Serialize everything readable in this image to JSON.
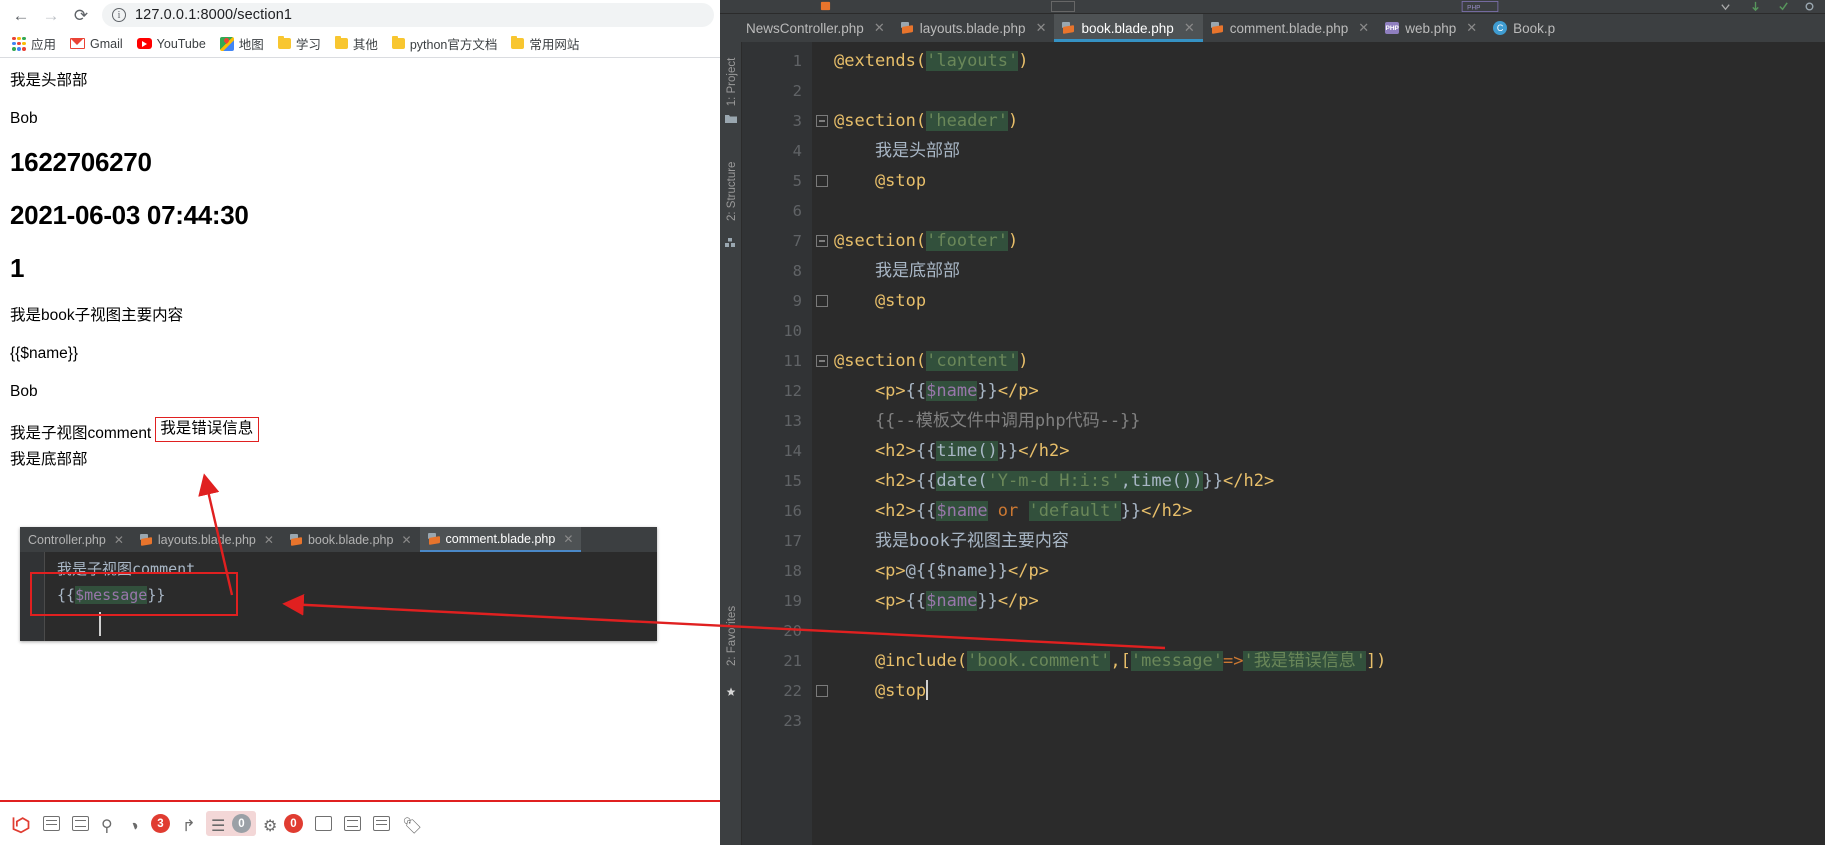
{
  "browser": {
    "nav": {
      "back": "←",
      "forward": "→",
      "reload": "⟳"
    },
    "omnibox": {
      "url": "127.0.0.1:8000/section1",
      "info_icon": "info-icon"
    },
    "bookmarks": [
      {
        "label": "应用",
        "icon": "apps-grid-icon"
      },
      {
        "label": "Gmail",
        "icon": "gmail-icon"
      },
      {
        "label": "YouTube",
        "icon": "youtube-icon"
      },
      {
        "label": "地图",
        "icon": "google-maps-icon"
      },
      {
        "label": "学习",
        "icon": "folder-icon"
      },
      {
        "label": "其他",
        "icon": "folder-icon"
      },
      {
        "label": "python官方文档",
        "icon": "folder-icon"
      },
      {
        "label": "常用网站",
        "icon": "folder-icon"
      }
    ]
  },
  "page": {
    "header_text": "我是头部部",
    "name_p": "Bob",
    "timestamp_h2": "1622706270",
    "date_h2": "2021-06-03 07:44:30",
    "default_h2": "1",
    "book_main": "我是book子视图主要内容",
    "raw_name": "{{$name}}",
    "name_p2": "Bob",
    "comment_label": "我是子视图comment",
    "error_message": "我是错误信息",
    "footer_text": "我是底部部"
  },
  "inset_editor": {
    "tabs": [
      {
        "label": "Controller.php",
        "active": false,
        "icon": "php-file-icon",
        "close": "✕"
      },
      {
        "label": "layouts.blade.php",
        "active": false,
        "icon": "blade-file-icon",
        "close": "✕"
      },
      {
        "label": "book.blade.php",
        "active": false,
        "icon": "blade-file-icon",
        "close": "✕"
      },
      {
        "label": "comment.blade.php",
        "active": true,
        "icon": "blade-file-icon",
        "close": "✕"
      }
    ],
    "lines": [
      {
        "text": "我是子视图comment",
        "highlighted": ""
      },
      {
        "prefix": "{{",
        "highlighted": "$message",
        "suffix": "}}"
      }
    ]
  },
  "debug_bar": {
    "items": [
      {
        "name": "laravel-logo",
        "badge": null
      },
      {
        "name": "messages-icon",
        "badge": null
      },
      {
        "name": "views-icon",
        "badge": null
      },
      {
        "name": "route-icon",
        "badge": null
      },
      {
        "name": "queries-icon",
        "badge": "3"
      },
      {
        "name": "redirect-icon",
        "badge": null
      },
      {
        "name": "models-icon",
        "badge": "0"
      },
      {
        "name": "session-icon",
        "badge": "0"
      },
      {
        "name": "mail-icon",
        "badge": null
      },
      {
        "name": "request-icon",
        "badge": null
      },
      {
        "name": "timeline-icon",
        "badge": null
      },
      {
        "name": "tag-icon",
        "badge": null
      }
    ]
  },
  "ide": {
    "sidebar": [
      {
        "label": "1: Project",
        "icon": "project-icon"
      },
      {
        "label": "2: Structure",
        "icon": "structure-icon"
      },
      {
        "label": "2: Favorites",
        "icon": "favorites-icon"
      }
    ],
    "tabs": [
      {
        "label": "NewsController.php",
        "active": false,
        "icon": "php-file-icon",
        "close": "✕"
      },
      {
        "label": "layouts.blade.php",
        "active": false,
        "icon": "blade-file-icon",
        "close": "✕"
      },
      {
        "label": "book.blade.php",
        "active": true,
        "icon": "blade-file-icon",
        "close": "✕"
      },
      {
        "label": "comment.blade.php",
        "active": false,
        "icon": "blade-file-icon",
        "close": "✕"
      },
      {
        "label": "web.php",
        "active": false,
        "icon": "php-small-icon",
        "close": "✕"
      },
      {
        "label": "Book.p",
        "active": false,
        "icon": "class-icon",
        "close": ""
      }
    ],
    "line_numbers": [
      "1",
      "2",
      "3",
      "4",
      "5",
      "6",
      "7",
      "8",
      "9",
      "10",
      "11",
      "12",
      "13",
      "14",
      "15",
      "16",
      "17",
      "18",
      "19",
      "20",
      "21",
      "22",
      "23"
    ],
    "code": [
      {
        "n": 1,
        "tokens": [
          {
            "t": "@extends(",
            "c": "dir"
          },
          {
            "t": "'layouts'",
            "c": "str"
          },
          {
            "t": ")",
            "c": "dir"
          }
        ]
      },
      {
        "n": 2,
        "tokens": []
      },
      {
        "n": 3,
        "tokens": [
          {
            "t": "@section(",
            "c": "dir"
          },
          {
            "t": "'header'",
            "c": "str"
          },
          {
            "t": ")",
            "c": "dir"
          }
        ],
        "fold": "open"
      },
      {
        "n": 4,
        "tokens": [
          {
            "t": "    我是头部部",
            "c": "txt"
          }
        ]
      },
      {
        "n": 5,
        "tokens": [
          {
            "t": "    @stop",
            "c": "dir"
          }
        ],
        "fold": "close"
      },
      {
        "n": 6,
        "tokens": []
      },
      {
        "n": 7,
        "tokens": [
          {
            "t": "@section(",
            "c": "dir"
          },
          {
            "t": "'footer'",
            "c": "str"
          },
          {
            "t": ")",
            "c": "dir"
          }
        ],
        "fold": "open"
      },
      {
        "n": 8,
        "tokens": [
          {
            "t": "    我是底部部",
            "c": "txt"
          }
        ]
      },
      {
        "n": 9,
        "tokens": [
          {
            "t": "    @stop",
            "c": "dir"
          }
        ],
        "fold": "close"
      },
      {
        "n": 10,
        "tokens": []
      },
      {
        "n": 11,
        "tokens": [
          {
            "t": "@section(",
            "c": "dir"
          },
          {
            "t": "'content'",
            "c": "str"
          },
          {
            "t": ")",
            "c": "dir"
          }
        ],
        "fold": "open"
      },
      {
        "n": 12,
        "tokens": [
          {
            "t": "    <p>",
            "c": "tag"
          },
          {
            "t": "{{",
            "c": "txt"
          },
          {
            "t": "$name",
            "c": "var"
          },
          {
            "t": "}}",
            "c": "txt"
          },
          {
            "t": "</p>",
            "c": "tag"
          }
        ]
      },
      {
        "n": 13,
        "tokens": [
          {
            "t": "    {{--模板文件中调用php代码--}}",
            "c": "cmt"
          }
        ]
      },
      {
        "n": 14,
        "tokens": [
          {
            "t": "    <h2>",
            "c": "tag"
          },
          {
            "t": "{{",
            "c": "txt"
          },
          {
            "t": "time()",
            "c": "fn"
          },
          {
            "t": "}}",
            "c": "txt"
          },
          {
            "t": "</h2>",
            "c": "tag"
          }
        ]
      },
      {
        "n": 15,
        "tokens": [
          {
            "t": "    <h2>",
            "c": "tag"
          },
          {
            "t": "{{",
            "c": "txt"
          },
          {
            "t": "date(",
            "c": "fn"
          },
          {
            "t": "'Y-m-d H:i:s'",
            "c": "str"
          },
          {
            "t": ",time())",
            "c": "fn"
          },
          {
            "t": "}}",
            "c": "txt"
          },
          {
            "t": "</h2>",
            "c": "tag"
          }
        ]
      },
      {
        "n": 16,
        "tokens": [
          {
            "t": "    <h2>",
            "c": "tag"
          },
          {
            "t": "{{",
            "c": "txt"
          },
          {
            "t": "$name",
            "c": "var"
          },
          {
            "t": " or ",
            "c": "or"
          },
          {
            "t": "'default'",
            "c": "str"
          },
          {
            "t": "}}",
            "c": "txt"
          },
          {
            "t": "</h2>",
            "c": "tag"
          }
        ]
      },
      {
        "n": 17,
        "tokens": [
          {
            "t": "    我是book子视图主要内容",
            "c": "txt"
          }
        ]
      },
      {
        "n": 18,
        "tokens": [
          {
            "t": "    <p>",
            "c": "tag"
          },
          {
            "t": "@{{$name}}",
            "c": "txt"
          },
          {
            "t": "</p>",
            "c": "tag"
          }
        ]
      },
      {
        "n": 19,
        "tokens": [
          {
            "t": "    <p>",
            "c": "tag"
          },
          {
            "t": "{{",
            "c": "txt"
          },
          {
            "t": "$name",
            "c": "var"
          },
          {
            "t": "}}",
            "c": "txt"
          },
          {
            "t": "</p>",
            "c": "tag"
          }
        ]
      },
      {
        "n": 20,
        "tokens": []
      },
      {
        "n": 21,
        "tokens": [
          {
            "t": "    @include(",
            "c": "dir"
          },
          {
            "t": "'book.comment'",
            "c": "str"
          },
          {
            "t": ",[",
            "c": "dir"
          },
          {
            "t": "'message'",
            "c": "str"
          },
          {
            "t": "=>",
            "c": "or"
          },
          {
            "t": "'我是错误信息'",
            "c": "str"
          },
          {
            "t": "])",
            "c": "dir"
          }
        ]
      },
      {
        "n": 22,
        "tokens": [
          {
            "t": "    @stop",
            "c": "dir"
          }
        ],
        "fold": "close",
        "caret": true
      },
      {
        "n": 23,
        "tokens": []
      }
    ]
  },
  "annotations": {
    "message_box": "{{$message}}",
    "error_box": "我是错误信息",
    "include_box": "@include('book.comment',['message'=>'我是错误信息'])",
    "accent_red": "#e02020"
  }
}
